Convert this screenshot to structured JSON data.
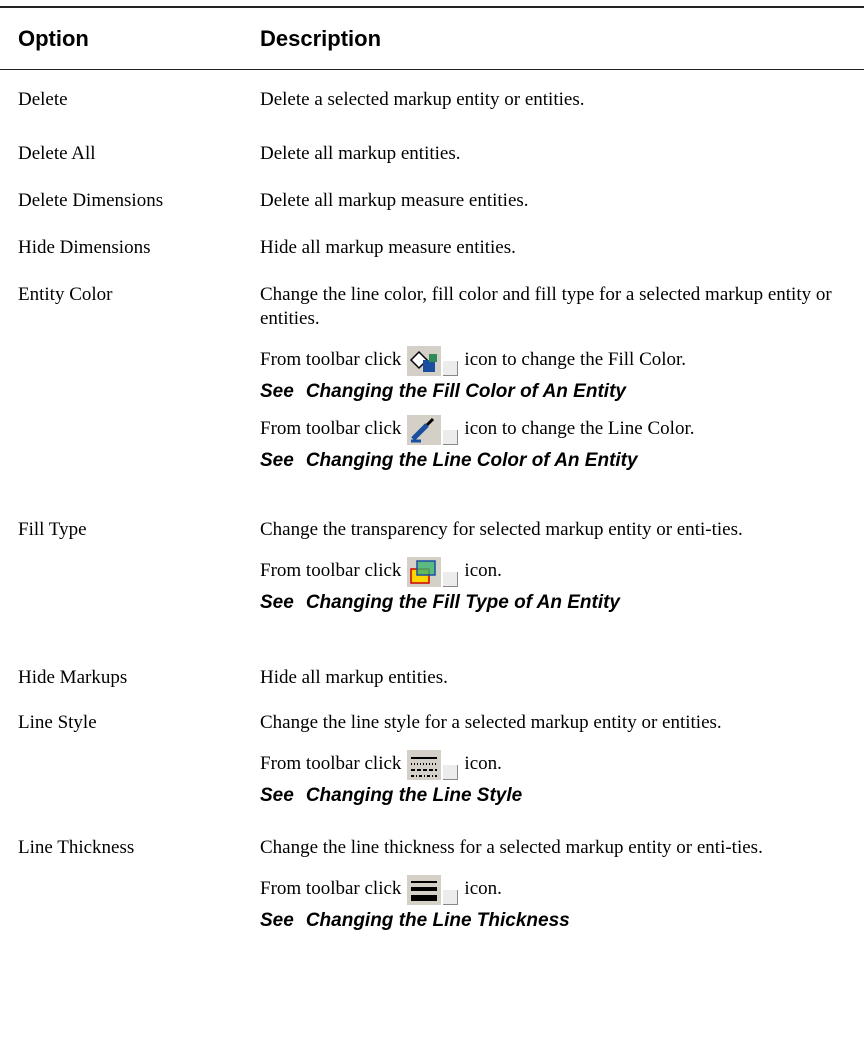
{
  "header": {
    "option": "Option",
    "description": "Description"
  },
  "rows": [
    {
      "option": "Delete",
      "desc": "Delete a selected markup entity or entities."
    },
    {
      "option": "Delete All",
      "desc": "Delete all markup entities."
    },
    {
      "option": "Delete Dimensions",
      "desc": "Delete all markup measure entities."
    },
    {
      "option": "Hide Dimensions",
      "desc": "Hide all markup measure entities."
    },
    {
      "option": "Entity Color",
      "desc": "Change the line color, fill color and fill type for a selected markup entity or entities.",
      "toolbar": [
        {
          "before": "From toolbar click",
          "icon": "fill-color-icon",
          "after": "icon to change the Fill Color.",
          "see_label": "See",
          "see_link": "Changing the Fill Color of An Entity"
        },
        {
          "before": "From toolbar click",
          "icon": "line-color-icon",
          "after": "icon to change the Line Color.",
          "see_label": "See",
          "see_link": "Changing the Line Color of An Entity"
        }
      ]
    },
    {
      "option": "Fill Type",
      "desc": "Change the transparency for selected markup entity or enti-ties.",
      "toolbar": [
        {
          "before": "From toolbar click",
          "icon": "fill-type-icon",
          "after": "icon.",
          "see_label": "See",
          "see_link": "Changing the Fill Type of An Entity"
        }
      ]
    },
    {
      "option": "Hide Markups",
      "desc": "Hide all markup entities."
    },
    {
      "option": "Line Style",
      "desc": "Change the line style for a selected markup entity or entities.",
      "toolbar": [
        {
          "before": "From toolbar click",
          "icon": "line-style-icon",
          "after": "icon.",
          "see_label": "See",
          "see_link": "Changing the Line Style"
        }
      ]
    },
    {
      "option": "Line Thickness",
      "desc": "Change the line thickness for a selected markup entity or enti-ties.",
      "toolbar": [
        {
          "before": "From toolbar click",
          "icon": "line-thickness-icon",
          "after": "icon.",
          "see_label": "See",
          "see_link": "Changing the Line Thickness"
        }
      ]
    }
  ]
}
